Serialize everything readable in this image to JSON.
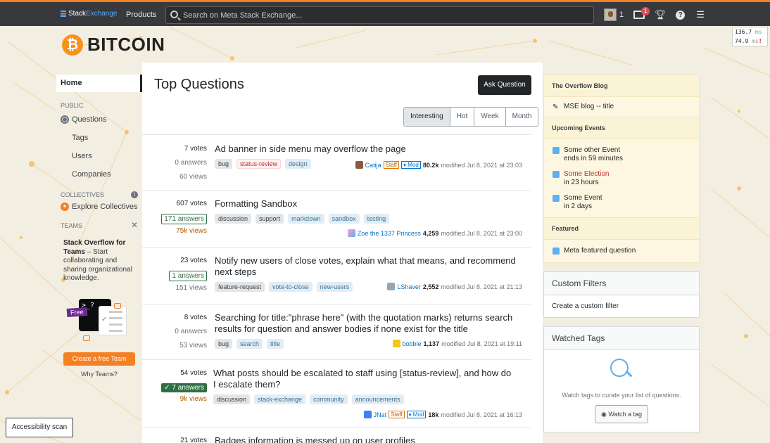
{
  "topbar": {
    "logo_stack": "Stack",
    "logo_exchange": "Exchange",
    "products": "Products",
    "search_placeholder": "Search on Meta Stack Exchange...",
    "rep": "1",
    "inbox_count": "1"
  },
  "perf": {
    "t1": "136.7",
    "t2": "74.9",
    "unit": "ms",
    "warn": "!"
  },
  "site": {
    "name": "BITCOIN",
    "logo_glyph": "₿"
  },
  "leftnav": {
    "home": "Home",
    "public": "PUBLIC",
    "questions": "Questions",
    "tags": "Tags",
    "users": "Users",
    "companies": "Companies",
    "collectives": "COLLECTIVES",
    "explore": "Explore Collectives",
    "teams": "TEAMS",
    "teams_title": "Stack Overflow for Teams",
    "teams_desc": "– Start collaborating and sharing organizational knowledge.",
    "free": "Free",
    "cta": "Create a free Team",
    "why": "Why Teams?"
  },
  "main": {
    "title": "Top Questions",
    "ask": "Ask Question",
    "filters": [
      "Interesting",
      "Hot",
      "Week",
      "Month"
    ]
  },
  "questions": [
    {
      "votes": "7 votes",
      "answers": "0 answers",
      "views": "60 views",
      "title": "Ad banner in side menu may overflow the page",
      "tags": [
        {
          "t": "bug",
          "k": "meta"
        },
        {
          "t": "status-review",
          "k": "mod"
        },
        {
          "t": "design",
          "k": "n"
        }
      ],
      "user": "Catija",
      "staff": "Staff",
      "mod": "♦ Mod",
      "rep": "80.2k",
      "time": "modified Jul 8, 2021 at 23:03"
    },
    {
      "votes": "607 votes",
      "answers": "171 answers",
      "views": "75k views",
      "title": "Formatting Sandbox",
      "tags": [
        {
          "t": "discussion",
          "k": "meta"
        },
        {
          "t": "support",
          "k": "meta"
        },
        {
          "t": "markdown",
          "k": "n"
        },
        {
          "t": "sandbox",
          "k": "n"
        },
        {
          "t": "testing",
          "k": "n"
        }
      ],
      "user": "Zoe the 1337 Princess",
      "rep": "4,259",
      "time": "modified Jul 8, 2021 at 23:00"
    },
    {
      "votes": "23 votes",
      "answers": "1 answers",
      "views": "151 views",
      "title": "Notify new users of close votes, explain what that means, and recommend next steps",
      "tags": [
        {
          "t": "feature-request",
          "k": "meta"
        },
        {
          "t": "vote-to-close",
          "k": "n"
        },
        {
          "t": "new-users",
          "k": "n"
        }
      ],
      "user": "LShaver",
      "rep": "2,552",
      "time": "modified Jul 8, 2021 at 21:13"
    },
    {
      "votes": "8 votes",
      "answers": "0 answers",
      "views": "53 views",
      "title": "Searching for title:\"phrase here\" (with the quotation marks) returns search results for question and answer bodies if none exist for the title",
      "tags": [
        {
          "t": "bug",
          "k": "meta"
        },
        {
          "t": "search",
          "k": "n"
        },
        {
          "t": "title",
          "k": "n"
        }
      ],
      "user": "bobble",
      "rep": "1,137",
      "time": "modified Jul 8, 2021 at 19:11"
    },
    {
      "votes": "54 votes",
      "answers": "7 answers",
      "views": "9k views",
      "title": "What posts should be escalated to staff using [status-review], and how do I escalate them?",
      "tags": [
        {
          "t": "discussion",
          "k": "meta"
        },
        {
          "t": "stack-exchange",
          "k": "n"
        },
        {
          "t": "community",
          "k": "n"
        },
        {
          "t": "announcements",
          "k": "n"
        }
      ],
      "user": "JNat",
      "staff": "Staff",
      "mod": "♦ Mod",
      "rep": "18k",
      "time": "modified Jul 8, 2021 at 16:13"
    },
    {
      "votes": "21 votes",
      "title": "Badges information is messed up on user profiles"
    }
  ],
  "sidebar": {
    "blog_header": "The Overflow Blog",
    "blog_item": "MSE blog -- title",
    "events_header": "Upcoming Events",
    "events": [
      {
        "name": "Some other Event",
        "when": "ends in 59 minutes"
      },
      {
        "name": "Some Election",
        "when": "in 23 hours"
      },
      {
        "name": "Some Event",
        "when": "in 2 days"
      }
    ],
    "featured_header": "Featured",
    "featured_item": "Meta featured question",
    "custom_header": "Custom Filters",
    "custom_link": "Create a custom filter",
    "watched_header": "Watched Tags",
    "watched_text": "Watch tags to curate your list of questions.",
    "watch_btn": "Watch a tag"
  },
  "accessibility": "Accessibility scan",
  "colors": {
    "accent": "#f48024",
    "bitcoin": "#f7931a",
    "topbar": "#37393c"
  }
}
